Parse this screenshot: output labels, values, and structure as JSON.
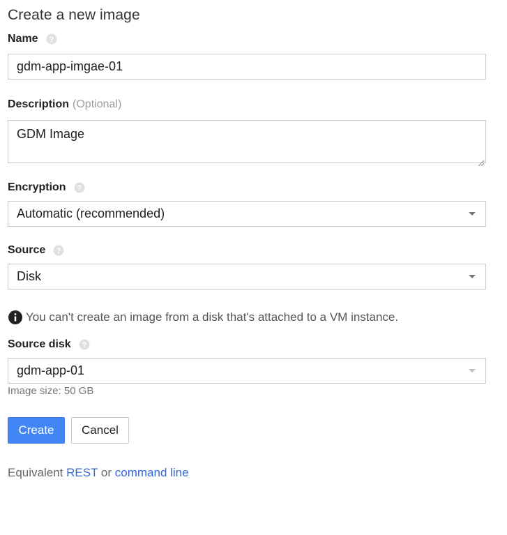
{
  "title": "Create a new image",
  "name": {
    "label": "Name",
    "value": "gdm-app-imgae-01"
  },
  "description": {
    "label": "Description",
    "optional_tag": "(Optional)",
    "value": "GDM Image"
  },
  "encryption": {
    "label": "Encryption",
    "selected": "Automatic (recommended)"
  },
  "source": {
    "label": "Source",
    "selected": "Disk"
  },
  "info": {
    "text": "You can't create an image from a disk that's attached to a VM instance."
  },
  "source_disk": {
    "label": "Source disk",
    "selected": "gdm-app-01",
    "image_size": "Image size: 50 GB"
  },
  "buttons": {
    "create": "Create",
    "cancel": "Cancel"
  },
  "footer": {
    "prefix": "Equivalent",
    "rest_link": "REST",
    "or": "or",
    "command_link": "command line"
  },
  "colors": {
    "primary_button": "#4285f4",
    "link": "#3367d6"
  },
  "icons": {
    "help": "help-circle-icon",
    "info": "info-circle-icon",
    "dropdown": "caret-down-icon",
    "resize": "resize-grip-icon"
  }
}
